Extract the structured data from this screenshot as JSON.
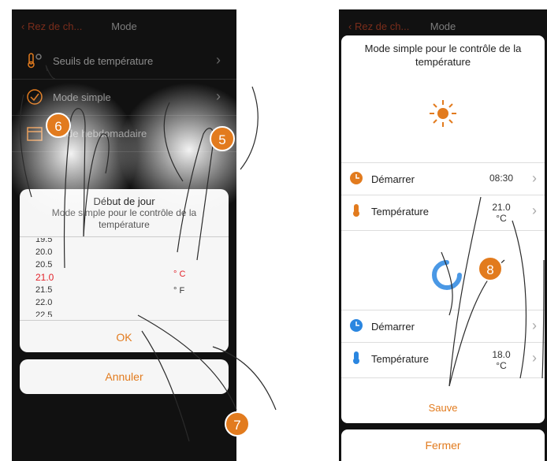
{
  "left_screen": {
    "header": {
      "back_label": "Rez de ch...",
      "title": "Mode"
    },
    "menu": [
      {
        "label": "Seuils de température",
        "icon": "thermometer-settings-icon"
      },
      {
        "label": "Mode simple",
        "icon": "check-circle-icon"
      },
      {
        "label": "Mode hebdomadaire",
        "icon": "calendar-icon"
      }
    ],
    "picker_dialog": {
      "title": "Début de jour",
      "subtitle": "Mode simple pour le contrôle de la température",
      "values": [
        "19.5",
        "20.0",
        "20.5",
        "21.0",
        "21.5",
        "22.0",
        "22.5"
      ],
      "selected_value": "21.0",
      "units": [
        "° C",
        "° F"
      ],
      "selected_unit": "° C",
      "ok_label": "OK"
    },
    "cancel_label": "Annuler"
  },
  "right_screen": {
    "header": {
      "back_label": "Rez de ch...",
      "title": "Mode"
    },
    "panel": {
      "title": "Mode simple pour le contrôle de la température",
      "rows_top": [
        {
          "label": "Démarrer",
          "value": "08:30",
          "icon": "clock-orange-icon"
        },
        {
          "label": "Température",
          "value": "21.0 °C",
          "icon": "thermometer-orange-icon"
        }
      ],
      "rows_bottom": [
        {
          "label": "Démarrer",
          "value": "",
          "icon": "clock-blue-icon"
        },
        {
          "label": "Température",
          "value": "18.0 °C",
          "icon": "thermometer-blue-icon"
        }
      ],
      "save_label": "Sauve"
    },
    "close_label": "Fermer"
  },
  "step_badges": [
    "5",
    "6",
    "7",
    "8"
  ],
  "colors": {
    "accent": "#e27b1e",
    "selected_red": "#e2232a",
    "blue": "#2a86e0",
    "phone_bg": "#111111"
  }
}
